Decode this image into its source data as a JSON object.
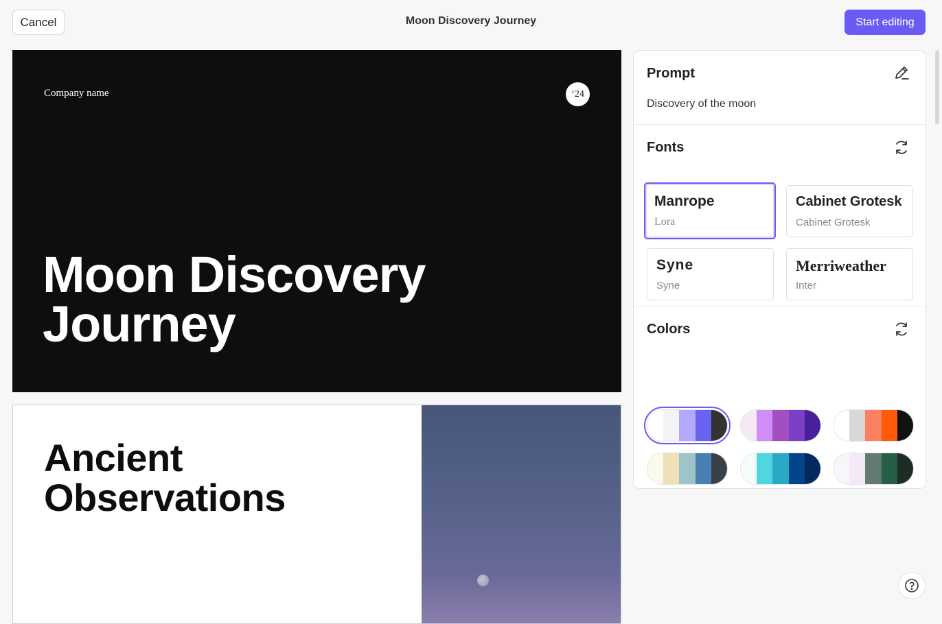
{
  "header": {
    "cancel_label": "Cancel",
    "title": "Moon Discovery Journey",
    "start_label": "Start editing"
  },
  "slide1": {
    "company": "Company name",
    "year": "‘24",
    "title_line1": "Moon Discovery",
    "title_line2": "Journey"
  },
  "slide2": {
    "title_line1": "Ancient",
    "title_line2": "Observations"
  },
  "panel": {
    "prompt": {
      "title": "Prompt",
      "text": "Discovery of the moon",
      "action_icon": "pencil-icon"
    },
    "fonts": {
      "title": "Fonts",
      "action_icon": "refresh-icon",
      "options": [
        {
          "main": "Manrope",
          "sub": "Lora",
          "selected": true
        },
        {
          "main": "Cabinet Grotesk",
          "sub": "Cabinet Grotesk",
          "selected": false
        },
        {
          "main": "Syne",
          "sub": "Syne",
          "selected": false
        },
        {
          "main": "Merriweather",
          "sub": "Inter",
          "selected": false
        }
      ]
    },
    "colors": {
      "title": "Colors",
      "action_icon": "refresh-icon",
      "palettes": [
        [
          "#ffffff",
          "#f3f3f5",
          "#b3a9fb",
          "#6a63f2",
          "#333333"
        ],
        [
          "#f5eaf3",
          "#cf8ef5",
          "#a34fc2",
          "#7a3fc6",
          "#4a1f9c"
        ],
        [
          "#ffffff",
          "#d8d8d8",
          "#fc8160",
          "#ff5a0a",
          "#111111"
        ],
        [
          "#fbf8ec",
          "#eee0b7",
          "#9ec3c9",
          "#4a7fb1",
          "#3a4047"
        ],
        [
          "#f4fcfc",
          "#4fd6e0",
          "#2aa9c5",
          "#02458a",
          "#032a5f"
        ],
        [
          "#f8f6fb",
          "#f4e9f7",
          "#637a72",
          "#275e47",
          "#1c2d25"
        ],
        [
          "#fdfaf1",
          "#cde9eb",
          "#f3c449",
          "#f5a50b",
          "#3b3a46"
        ],
        [
          "#fafafa",
          "#cddfce",
          "#9bb8f0",
          "#5a9cf3",
          "#485268"
        ],
        [
          "#ffffff",
          "#d6d6d6",
          "#9a9a9a",
          "#2b2b2b",
          "#000000"
        ]
      ]
    }
  },
  "help_icon": "question-icon"
}
